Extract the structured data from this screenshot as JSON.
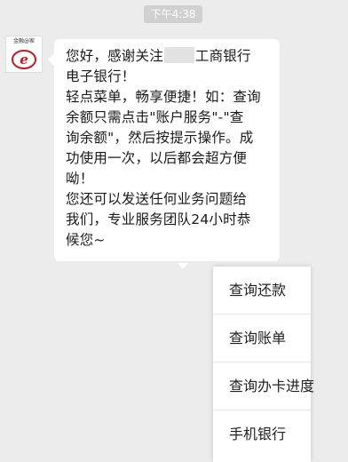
{
  "chat": {
    "timestamp": "下午4:38",
    "avatar": {
      "line1": "金融@家"
    },
    "message": {
      "line1_a": "您好，感谢关注",
      "line1_b": "工商银行",
      "lines": [
        "电子银行！",
        "轻点菜单，畅享便捷！如：查询",
        "余额只需点击\"账户服务\"-\"查",
        "询余额\"，然后按提示操作。成",
        "功使用一次，以后都会超方便",
        "呦！",
        "您还可以发送任何业务问题给",
        "我们，专业服务团队24小时恭",
        "候您~"
      ]
    }
  },
  "menu": {
    "items": [
      "查询还款",
      "查询账单",
      "查询办卡进度",
      "手机银行"
    ]
  },
  "colors": {
    "background": "#ececec",
    "bubble": "#ffffff",
    "icbc_red": "#c8161d"
  }
}
